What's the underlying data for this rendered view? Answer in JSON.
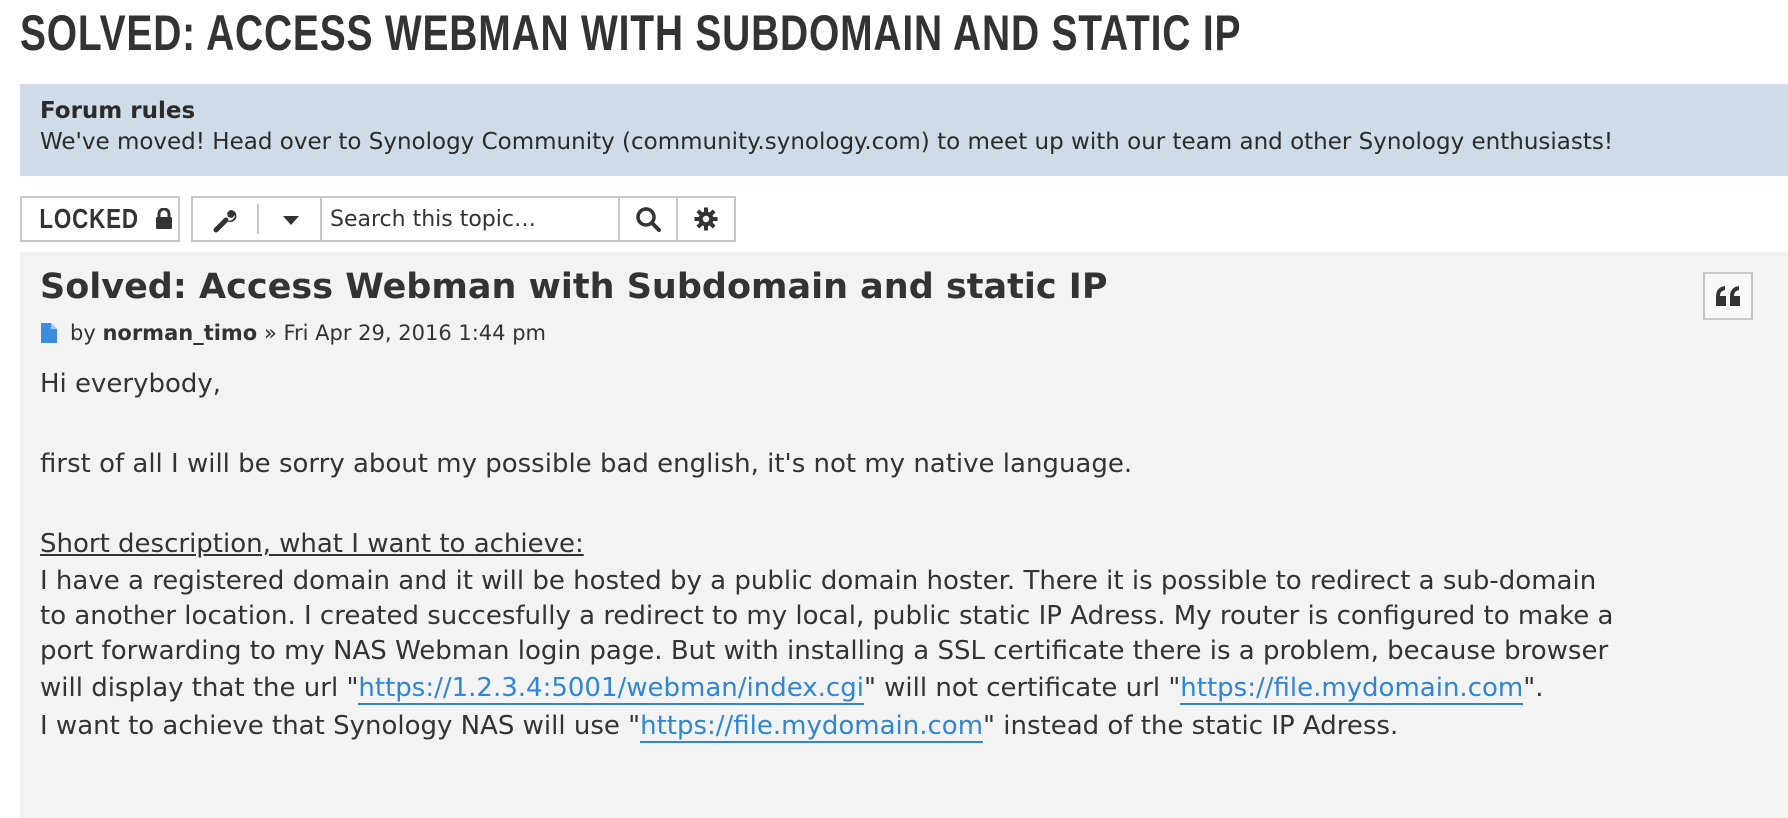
{
  "page": {
    "title": "SOLVED: ACCESS WEBMAN WITH SUBDOMAIN AND STATIC IP"
  },
  "forum_rules": {
    "heading": "Forum rules",
    "text": "We've moved! Head over to Synology Community (community.synology.com) to meet up with our team and other Synology enthusiasts!"
  },
  "toolbar": {
    "locked_label": "LOCKED",
    "lock_icon": "lock-icon",
    "tools_icon": "wrench-icon",
    "dropdown_icon": "caret-down-icon",
    "search_placeholder": "Search this topic…",
    "search_icon": "search-icon",
    "advanced_icon": "gear-icon"
  },
  "post": {
    "title": "Solved: Access Webman with Subdomain and static IP",
    "by": "by",
    "author": "norman_timo",
    "separator": "»",
    "date": "Fri Apr 29, 2016 1:44 pm",
    "quote_icon": "quote-icon",
    "post_icon": "file-icon",
    "greeting": "Hi everybody,",
    "intro": "first of all I will be sorry about my possible bad english, it's not my native language.",
    "section_heading": "Short description, what I want to achieve:",
    "line1": "I have a registered domain and it will be hosted by a public domain hoster. There it is possible to redirect a sub-domain",
    "line2": "to another location. I created succesfully a redirect to my local, public static IP Adress. My router is configured to make a",
    "line3": "port forwarding to my NAS Webman login page. But with installing a SSL certificate there is a problem, because browser",
    "line4_a": "will display that the url \"",
    "link1": "https://1.2.3.4:5001/webman/index.cgi",
    "line4_b": "\" will not certificate url \"",
    "link2": "https://file.mydomain.com",
    "line4_c": "\".",
    "line5_a": "I want to achieve that Synology NAS will use \"",
    "link3": "https://file.mydomain.com",
    "line5_b": "\" instead of the static IP Adress."
  },
  "colors": {
    "rules_bg": "#cfdbe6",
    "post_bg": "#f3f3f3",
    "link": "#2f86d6",
    "icon_blue": "#3b8de0"
  }
}
